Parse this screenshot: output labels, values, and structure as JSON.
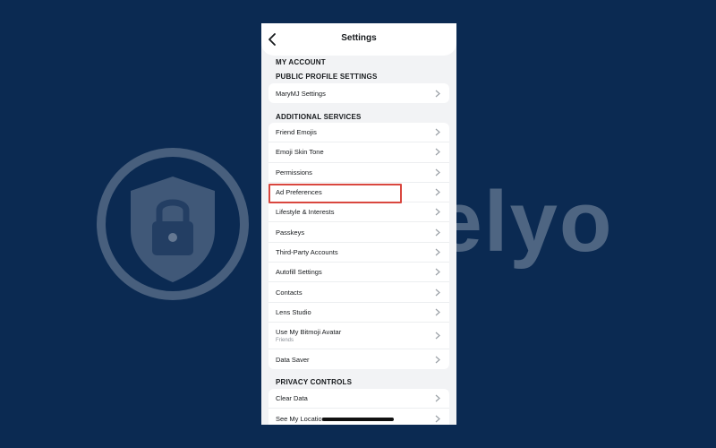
{
  "watermark": {
    "text": "Safelyo"
  },
  "header": {
    "title": "Settings"
  },
  "sections": {
    "my_account": "MY ACCOUNT",
    "public_profile": "PUBLIC PROFILE SETTINGS",
    "additional_services": "ADDITIONAL SERVICES",
    "privacy_controls": "PRIVACY CONTROLS"
  },
  "public_profile_items": [
    {
      "label": "MaryMJ Settings"
    }
  ],
  "additional_items": [
    {
      "label": "Friend Emojis"
    },
    {
      "label": "Emoji Skin Tone"
    },
    {
      "label": "Permissions"
    },
    {
      "label": "Ad Preferences"
    },
    {
      "label": "Lifestyle & Interests"
    },
    {
      "label": "Passkeys"
    },
    {
      "label": "Third-Party Accounts"
    },
    {
      "label": "Autofill Settings"
    },
    {
      "label": "Contacts"
    },
    {
      "label": "Lens Studio"
    },
    {
      "label": "Use My Bitmoji Avatar",
      "sub": "Friends"
    },
    {
      "label": "Data Saver"
    }
  ],
  "privacy_items": [
    {
      "label": "Clear Data"
    },
    {
      "label": "See My Location"
    }
  ],
  "colors": {
    "background": "#0b2a52",
    "highlight": "#d9473f"
  }
}
